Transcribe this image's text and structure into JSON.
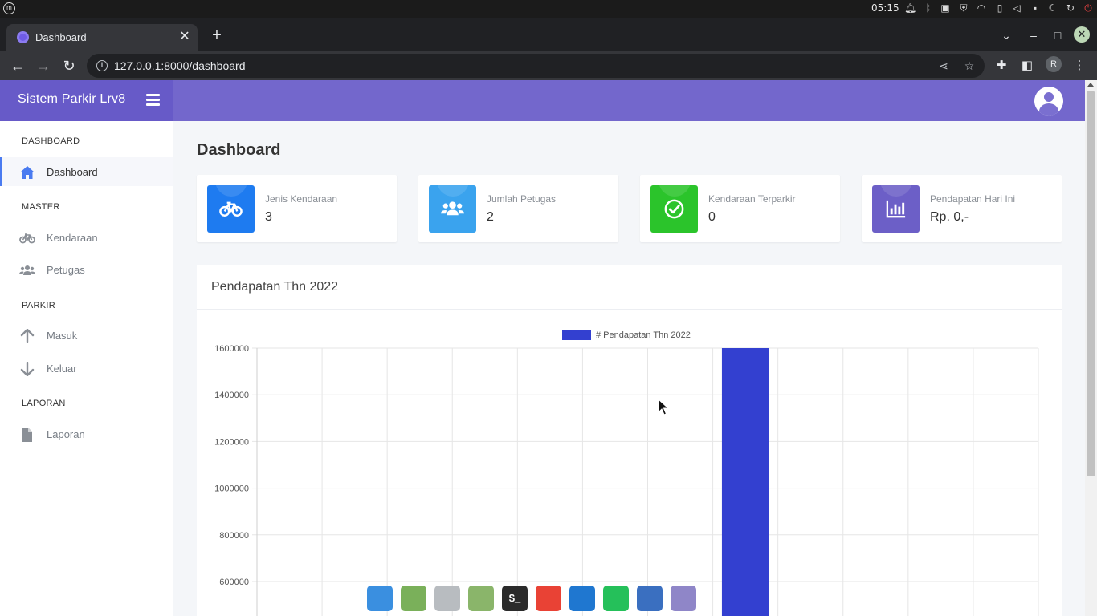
{
  "os": {
    "clock": "05:15",
    "colors": {
      "bar": "#1b1b1b",
      "power": "#e04040"
    }
  },
  "browser": {
    "tab_title": "Dashboard",
    "url": "127.0.0.1:8000/dashboard",
    "profile_initial": "R"
  },
  "app": {
    "brand": "Sistem Parkir Lrv8",
    "colors": {
      "brand": "#675ac8",
      "header": "#7367cc",
      "accent": "#4a7bf0"
    }
  },
  "sidebar": {
    "sections": [
      {
        "heading": "DASHBOARD",
        "items": [
          {
            "label": "Dashboard",
            "icon": "home-icon",
            "active": true
          }
        ]
      },
      {
        "heading": "MASTER",
        "items": [
          {
            "label": "Kendaraan",
            "icon": "bicycle-icon"
          },
          {
            "label": "Petugas",
            "icon": "users-icon"
          }
        ]
      },
      {
        "heading": "PARKIR",
        "items": [
          {
            "label": "Masuk",
            "icon": "arrow-up-icon"
          },
          {
            "label": "Keluar",
            "icon": "arrow-down-icon"
          }
        ]
      },
      {
        "heading": "LAPORAN",
        "items": [
          {
            "label": "Laporan",
            "icon": "file-icon"
          }
        ]
      }
    ]
  },
  "main": {
    "page_title": "Dashboard",
    "info_boxes": [
      {
        "label": "Jenis Kendaraan",
        "value": "3",
        "icon": "bicycle-icon",
        "color": "#1e7bf0"
      },
      {
        "label": "Jumlah Petugas",
        "value": "2",
        "icon": "users-icon",
        "color": "#3aa3ee"
      },
      {
        "label": "Kendaraan Terparkir",
        "value": "0",
        "icon": "check-circle-icon",
        "color": "#2bc42b"
      },
      {
        "label": "Pendapatan Hari Ini",
        "value": "Rp. 0,-",
        "icon": "bar-chart-icon",
        "color": "#6c5fc7"
      }
    ],
    "chart_card_title": "Pendapatan Thn 2022"
  },
  "chart_data": {
    "type": "bar",
    "legend": "# Pendapatan Thn 2022",
    "legend_position": "top",
    "series": [
      {
        "name": "# Pendapatan Thn 2022",
        "color": "#3340d0",
        "values": [
          0,
          0,
          0,
          0,
          0,
          0,
          0,
          1600000,
          0,
          0,
          0,
          0
        ]
      }
    ],
    "y_ticks": [
      1600000,
      1400000,
      1200000,
      1000000,
      800000,
      600000
    ],
    "ylim_visible": [
      600000,
      1600000
    ],
    "grid": true
  },
  "dock": {
    "apps": [
      {
        "icon": "desktop-icon",
        "color": "#3a8fe0"
      },
      {
        "icon": "folder-icon",
        "color": "#7ab05a"
      },
      {
        "icon": "settings-toggle-icon",
        "color": "#b8bcc0"
      },
      {
        "icon": "spreadsheet-icon",
        "color": "#8ab56a"
      },
      {
        "icon": "terminal-icon",
        "color": "#2b2b2b",
        "glyph": "$_"
      },
      {
        "icon": "chrome-icon",
        "color": "#e94235"
      },
      {
        "icon": "vscode-icon",
        "color": "#1f77d0"
      },
      {
        "icon": "whatsapp-icon",
        "color": "#25c05a"
      },
      {
        "icon": "tasks-icon",
        "color": "#3a6fc0"
      },
      {
        "icon": "text-editor-icon",
        "color": "#8f86c8"
      }
    ]
  }
}
